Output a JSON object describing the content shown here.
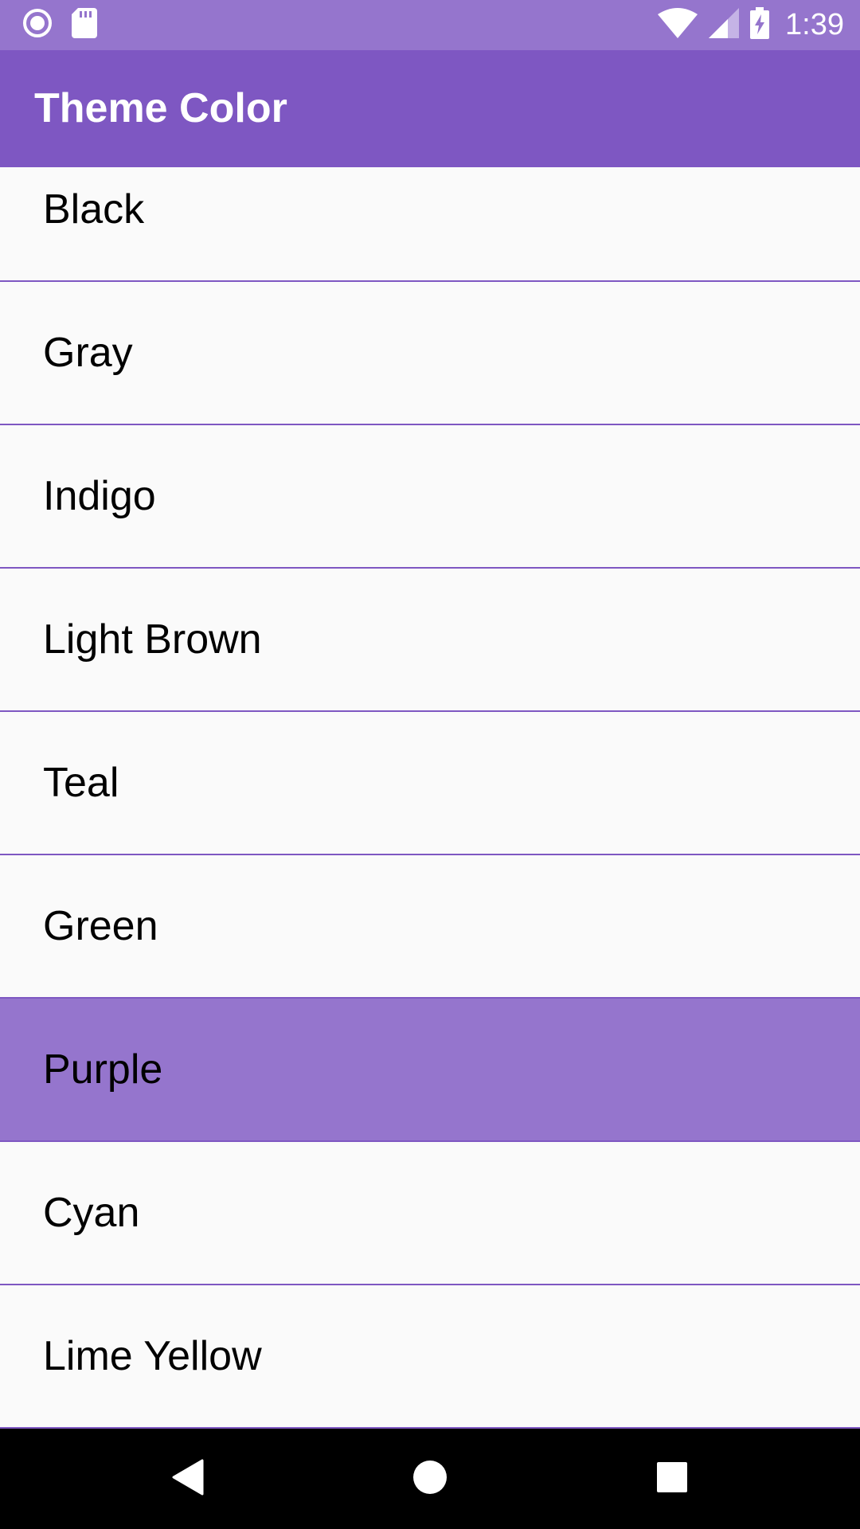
{
  "status_bar": {
    "time": "1:39",
    "left_icons": [
      "radio-icon",
      "sd-card-icon"
    ],
    "right_icons": [
      "wifi-icon",
      "signal-icon",
      "battery-charging-icon"
    ],
    "color": "#9575cd"
  },
  "app_bar": {
    "title": "Theme Color",
    "color": "#7e57c2"
  },
  "theme_list": {
    "items": [
      {
        "label": "Black",
        "selected": false
      },
      {
        "label": "Gray",
        "selected": false
      },
      {
        "label": "Indigo",
        "selected": false
      },
      {
        "label": "Light Brown",
        "selected": false
      },
      {
        "label": "Teal",
        "selected": false
      },
      {
        "label": "Green",
        "selected": false
      },
      {
        "label": "Purple",
        "selected": true
      },
      {
        "label": "Cyan",
        "selected": false
      },
      {
        "label": "Lime Yellow",
        "selected": false
      }
    ],
    "divider_color": "#7e57c2",
    "selected_color": "#9575cd"
  },
  "nav_bar": {
    "buttons": [
      "back-icon",
      "home-icon",
      "recents-icon"
    ]
  }
}
